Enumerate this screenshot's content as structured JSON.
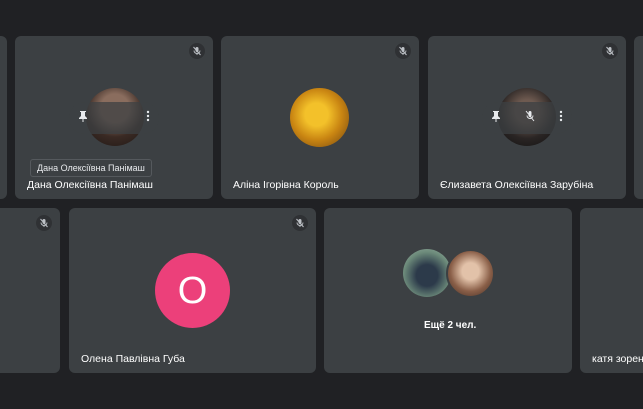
{
  "participants": [
    {
      "name": "Дана Олексіївна Панімаш",
      "tooltip": "Дана Олексіївна Панімаш"
    },
    {
      "name": "Аліна Ігорівна Король"
    },
    {
      "name": "Єлизавета Олексіївна Зарубіна"
    },
    {
      "name": "Олена Павлівна Губа",
      "initial": "О",
      "avatar_color": "#ec407a"
    },
    {
      "name": "катя зорень"
    }
  ],
  "overflow_tile": {
    "label": "Ещё 2 чел."
  },
  "icons": {
    "mic": "mic-off-icon",
    "pin": "pin-icon",
    "more": "more-vert-icon"
  }
}
